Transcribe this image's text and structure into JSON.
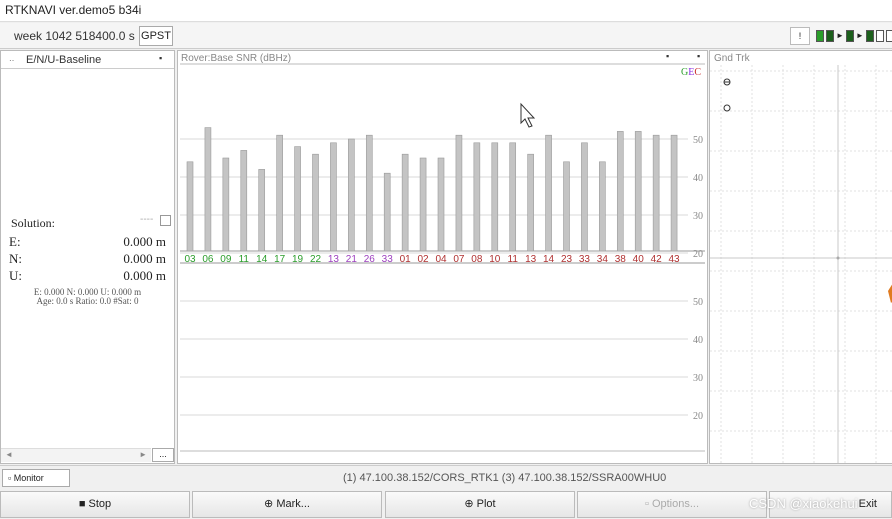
{
  "window": {
    "title": "RTKNAVI ver.demo5 b34i"
  },
  "toolbar": {
    "time": "week 1042 518400.0 s",
    "time_system": "GPST",
    "indicator": "!"
  },
  "left_panel": {
    "title": "E/N/U-Baseline",
    "solution_label": "Solution:",
    "solution_dash": "----",
    "e_label": "E:",
    "e_value": "0.000 m",
    "n_label": "N:",
    "n_value": "0.000 m",
    "u_label": "U:",
    "u_value": "0.000 m",
    "info_line1": "E: 0.000 N: 0.000 U: 0.000 m",
    "info_line2": "Age: 0.0 s Ratio: 0.0 #Sat: 0",
    "more_button": "..."
  },
  "mid_panel": {
    "title": "Rover:Base  SNR (dBHz)",
    "legend_g": "G",
    "legend_e": "E",
    "legend_c": "C"
  },
  "chart_data": {
    "type": "bar",
    "ylabel": "",
    "yticks": [
      20,
      30,
      40,
      50
    ],
    "ylim": [
      10,
      55
    ],
    "grid": true,
    "categories": [
      "03",
      "06",
      "09",
      "11",
      "14",
      "17",
      "19",
      "22",
      "13",
      "21",
      "26",
      "33",
      "01",
      "02",
      "04",
      "07",
      "08",
      "10",
      "11",
      "13",
      "14",
      "23",
      "33",
      "34",
      "38",
      "40",
      "42",
      "43"
    ],
    "category_colors": [
      "#2a9d2a",
      "#2a9d2a",
      "#2a9d2a",
      "#2a9d2a",
      "#2a9d2a",
      "#2a9d2a",
      "#2a9d2a",
      "#2a9d2a",
      "#9c3fbf",
      "#9c3fbf",
      "#9c3fbf",
      "#9c3fbf",
      "#b03030",
      "#b03030",
      "#b03030",
      "#b03030",
      "#b03030",
      "#b03030",
      "#b03030",
      "#b03030",
      "#b03030",
      "#b03030",
      "#b03030",
      "#b03030",
      "#b03030",
      "#b03030",
      "#b03030",
      "#b03030"
    ],
    "values": [
      44,
      53,
      45,
      47,
      42,
      51,
      48,
      46,
      49,
      50,
      51,
      41,
      46,
      45,
      45,
      51,
      49,
      49,
      49,
      46,
      51,
      44,
      49,
      44,
      52,
      52,
      51,
      51
    ],
    "base_yticks": [
      20,
      30,
      40,
      50
    ]
  },
  "right_panel": {
    "title": "Gnd Trk"
  },
  "status": {
    "monitor_label": "Monitor",
    "stream": "(1) 47.100.38.152/CORS_RTK1 (3) 47.100.38.152/SSRA00WHU0"
  },
  "buttons": {
    "stop": "Stop",
    "mark": "Mark...",
    "plot": "Plot",
    "options": "Options...",
    "exit": "Exit"
  },
  "watermark": "CSDN @xiaokehui"
}
